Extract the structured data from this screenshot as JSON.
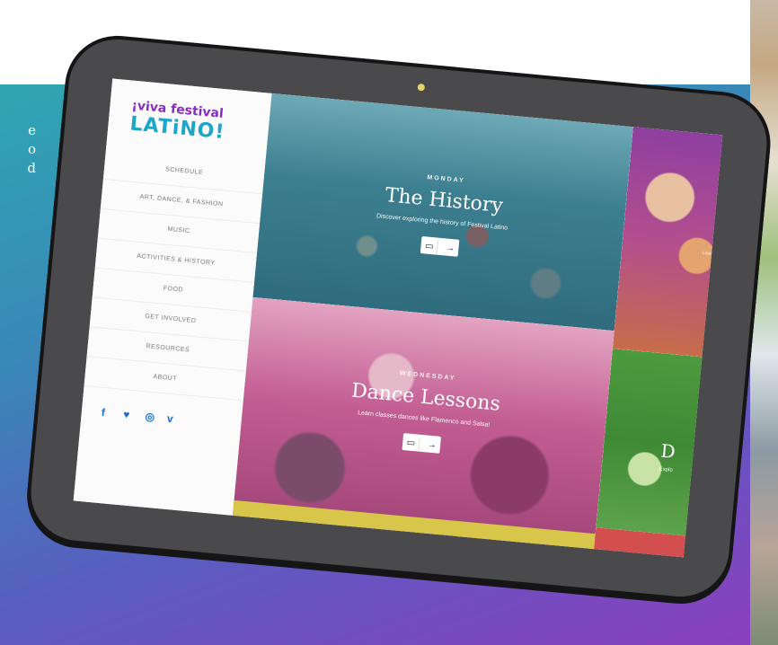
{
  "intro": {
    "lines": [
      "e",
      "o",
      "d"
    ]
  },
  "site": {
    "logo": {
      "line1": "¡viva festival",
      "line2": "LATiNO!"
    },
    "nav": [
      "SCHEDULE",
      "ART, DANCE, & FASHION",
      "MUSIC",
      "ACTIVITIES & HISTORY",
      "FOOD",
      "GET INVOLVED",
      "RESOURCES",
      "ABOUT"
    ],
    "social": [
      "f",
      "♥",
      "◎",
      "v"
    ]
  },
  "panels": {
    "top": {
      "day": "MONDAY",
      "title": "The History",
      "description": "Discover exploring the history of Festival Latino",
      "buttons": [
        "▭",
        "→"
      ]
    },
    "middle": {
      "day": "WEDNESDAY",
      "title": "Dance Lessons",
      "description": "Learn classes dances like Flamenco and Salsa!",
      "buttons": [
        "▭",
        "→"
      ]
    },
    "right_top": {
      "description": "Learn"
    },
    "right_middle": {
      "title": "D",
      "description": "Explo"
    }
  },
  "colors": {
    "background_start": "#2fa6b3",
    "background_end": "#8b3fbf",
    "tablet_bezel": "#4a4a4c",
    "accent_pink": "#c35e93",
    "accent_green": "#4c9a3e",
    "accent_yellow": "#d8c64a",
    "accent_red": "#d34f4f",
    "logo_purple": "#8a2bbf",
    "logo_blue": "#1ca7c8"
  }
}
